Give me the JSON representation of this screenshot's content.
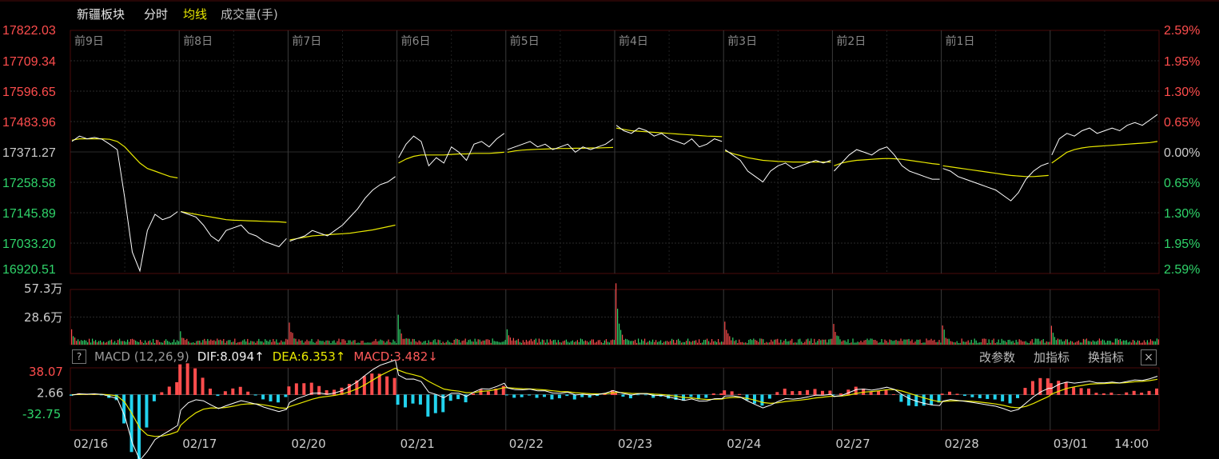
{
  "header": {
    "title": "新疆板块",
    "mode": "分时",
    "avg_label": "均线",
    "volume_label": "成交量(手)"
  },
  "colors": {
    "up": "#ff4d4d",
    "down": "#2fd46a",
    "price_line": "#ffffff",
    "avg_line": "#e8e800",
    "grid": "#3a0000",
    "neutral": "#cccccc",
    "macd_neg": "#22d3ee"
  },
  "macd_bar": {
    "help_icon": "?",
    "label": "MACD (12,26,9)",
    "dif": "DIF:8.094",
    "dif_arrow": "↑",
    "dea": "DEA:6.353",
    "dea_arrow": "↑",
    "macd": "MACD:3.482",
    "macd_arrow": "↓",
    "btn_params": "改参数",
    "btn_add": "加指标",
    "btn_switch": "换指标",
    "close_icon": "×"
  },
  "chart_data": {
    "type": "line",
    "prev_close": 17371.27,
    "price_ylim": [
      16920.51,
      17822.03
    ],
    "price_ticks": [
      "17822.03",
      "17709.34",
      "17596.65",
      "17483.96",
      "17371.27",
      "17258.58",
      "17145.89",
      "17033.20",
      "16920.51"
    ],
    "pct_ticks": [
      "2.59%",
      "1.95%",
      "1.30%",
      "0.65%",
      "0.00%",
      "0.65%",
      "1.30%",
      "1.95%",
      "2.59%"
    ],
    "day_labels": [
      "前9日",
      "前8日",
      "前7日",
      "前6日",
      "前5日",
      "前4日",
      "前3日",
      "前2日",
      "前1日"
    ],
    "dates": [
      "02/16",
      "02/17",
      "02/20",
      "02/21",
      "02/22",
      "02/23",
      "02/24",
      "02/27",
      "02/28",
      "03/01",
      "14:00"
    ],
    "series": [
      {
        "values": [
          [
            17410,
            17430,
            17420,
            17425,
            17418,
            17400,
            17380,
            17200,
            17000,
            16930,
            17080,
            17140,
            17120,
            17130,
            17150
          ],
          [
            17150,
            17140,
            17130,
            17100,
            17060,
            17040,
            17080,
            17090,
            17100,
            17070,
            17060,
            17040,
            17030,
            17020,
            17050
          ],
          [
            17040,
            17050,
            17060,
            17080,
            17070,
            17060,
            17080,
            17100,
            17130,
            17160,
            17200,
            17230,
            17250,
            17260,
            17280
          ],
          [
            17350,
            17400,
            17430,
            17410,
            17320,
            17350,
            17330,
            17390,
            17370,
            17340,
            17400,
            17410,
            17390,
            17420,
            17440
          ],
          [
            17380,
            17390,
            17400,
            17410,
            17390,
            17400,
            17380,
            17390,
            17400,
            17370,
            17390,
            17380,
            17390,
            17400,
            17420
          ],
          [
            17470,
            17450,
            17440,
            17460,
            17450,
            17430,
            17440,
            17420,
            17410,
            17400,
            17420,
            17390,
            17400,
            17420,
            17410
          ],
          [
            17380,
            17360,
            17340,
            17300,
            17280,
            17260,
            17300,
            17320,
            17330,
            17310,
            17320,
            17330,
            17340,
            17330,
            17340
          ],
          [
            17300,
            17330,
            17360,
            17380,
            17370,
            17360,
            17380,
            17390,
            17360,
            17320,
            17300,
            17290,
            17280,
            17270,
            17270
          ],
          [
            17310,
            17300,
            17280,
            17270,
            17260,
            17250,
            17240,
            17230,
            17210,
            17190,
            17220,
            17270,
            17300,
            17320,
            17330
          ],
          [
            17360,
            17420,
            17440,
            17430,
            17450,
            17460,
            17440,
            17450,
            17460,
            17450,
            17470,
            17480,
            17470,
            17490,
            17510
          ]
        ]
      },
      {
        "values": [
          [
            17415,
            17420,
            17420,
            17420,
            17420,
            17418,
            17410,
            17390,
            17360,
            17330,
            17310,
            17300,
            17290,
            17280,
            17275
          ],
          [
            17150,
            17145,
            17140,
            17135,
            17130,
            17125,
            17120,
            17118,
            17117,
            17116,
            17115,
            17114,
            17113,
            17112,
            17110
          ],
          [
            17045,
            17050,
            17055,
            17060,
            17062,
            17064,
            17066,
            17068,
            17070,
            17074,
            17078,
            17082,
            17088,
            17094,
            17100
          ],
          [
            17330,
            17345,
            17355,
            17360,
            17360,
            17360,
            17360,
            17362,
            17364,
            17364,
            17366,
            17366,
            17366,
            17368,
            17370
          ],
          [
            17370,
            17375,
            17378,
            17380,
            17381,
            17382,
            17383,
            17384,
            17384,
            17385,
            17385,
            17386,
            17386,
            17387,
            17388
          ],
          [
            17460,
            17455,
            17450,
            17448,
            17446,
            17444,
            17442,
            17440,
            17438,
            17436,
            17434,
            17432,
            17430,
            17429,
            17428
          ],
          [
            17375,
            17365,
            17358,
            17350,
            17345,
            17340,
            17338,
            17336,
            17335,
            17334,
            17334,
            17334,
            17334,
            17334,
            17334
          ],
          [
            17320,
            17330,
            17336,
            17340,
            17342,
            17344,
            17346,
            17347,
            17346,
            17344,
            17340,
            17336,
            17332,
            17328,
            17325
          ],
          [
            17320,
            17316,
            17312,
            17308,
            17304,
            17300,
            17296,
            17292,
            17288,
            17284,
            17282,
            17280,
            17280,
            17282,
            17284
          ],
          [
            17330,
            17350,
            17370,
            17380,
            17386,
            17390,
            17392,
            17394,
            17396,
            17398,
            17400,
            17402,
            17404,
            17406,
            17410
          ]
        ]
      }
    ],
    "volume": {
      "ylabels": [
        "57.3万",
        "28.6万"
      ],
      "ylim": [
        0,
        57.3
      ],
      "open_spikes": [
        12,
        10,
        20,
        26,
        14,
        58,
        20,
        18,
        18,
        16
      ],
      "base_level": 4
    },
    "macd": {
      "ylabels": [
        "38.07",
        "2.66",
        "-32.75"
      ],
      "ylim": [
        -60,
        45
      ]
    }
  }
}
